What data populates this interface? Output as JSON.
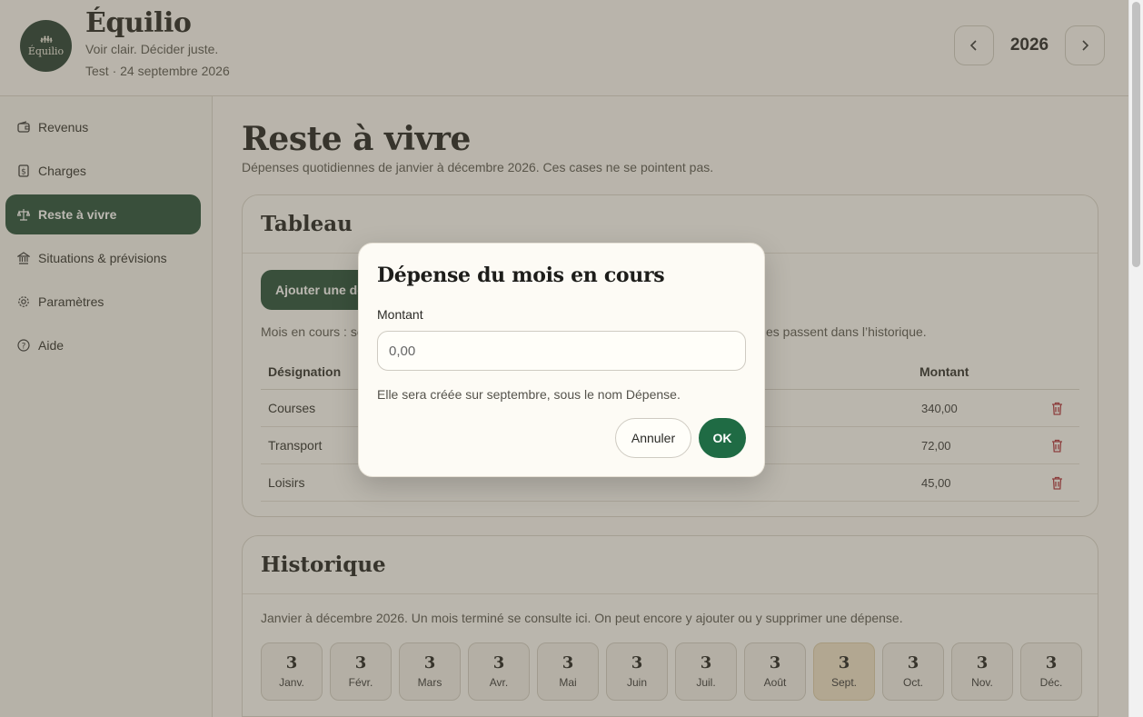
{
  "header": {
    "logo_text": "Équilio",
    "brand": "Équilio",
    "tagline": "Voir clair. Décider juste.",
    "user_line": "Test · 24 septembre 2026",
    "year": "2026"
  },
  "sidebar": {
    "items": [
      {
        "label": "Revenus",
        "icon": "wallet-icon"
      },
      {
        "label": "Charges",
        "icon": "dollar-file-icon"
      },
      {
        "label": "Reste à vivre",
        "icon": "scale-icon",
        "active": true
      },
      {
        "label": "Situations & prévisions",
        "icon": "bank-icon"
      },
      {
        "label": "Paramètres",
        "icon": "gear-icon"
      },
      {
        "label": "Aide",
        "icon": "help-circle-icon"
      }
    ]
  },
  "page": {
    "title": "Reste à vivre",
    "subtitle": "Dépenses quotidiennes de janvier à décembre 2026. Ces cases ne se pointent pas."
  },
  "tableau": {
    "title": "Tableau",
    "add_button": "Ajouter une dé",
    "info_left": "Mois en cours : se",
    "info_right": "es passent dans l’historique.",
    "col_designation": "Désignation",
    "col_montant": "Montant",
    "rows": [
      {
        "designation": "Courses",
        "montant": "340,00"
      },
      {
        "designation": "Transport",
        "montant": "72,00"
      },
      {
        "designation": "Loisirs",
        "montant": "45,00"
      }
    ]
  },
  "historique": {
    "title": "Historique",
    "description": "Janvier à décembre 2026. Un mois terminé se consulte ici. On peut encore y ajouter ou y supprimer une dépense.",
    "months": [
      {
        "count": "3",
        "label": "Janv."
      },
      {
        "count": "3",
        "label": "Févr."
      },
      {
        "count": "3",
        "label": "Mars"
      },
      {
        "count": "3",
        "label": "Avr."
      },
      {
        "count": "3",
        "label": "Mai"
      },
      {
        "count": "3",
        "label": "Juin"
      },
      {
        "count": "3",
        "label": "Juil."
      },
      {
        "count": "3",
        "label": "Août"
      },
      {
        "count": "3",
        "label": "Sept.",
        "current": true
      },
      {
        "count": "3",
        "label": "Oct."
      },
      {
        "count": "3",
        "label": "Nov."
      },
      {
        "count": "3",
        "label": "Déc."
      }
    ]
  },
  "modal": {
    "title": "Dépense du mois en cours",
    "field_label": "Montant",
    "field_placeholder": "0,00",
    "hint": "Elle sera créée sur septembre, sous le nom Dépense.",
    "cancel": "Annuler",
    "ok": "OK"
  },
  "colors": {
    "accent": "#1f4a34",
    "ok_button": "#1f6b44",
    "delete": "#b0303a",
    "current_month": "#efe2c8"
  }
}
